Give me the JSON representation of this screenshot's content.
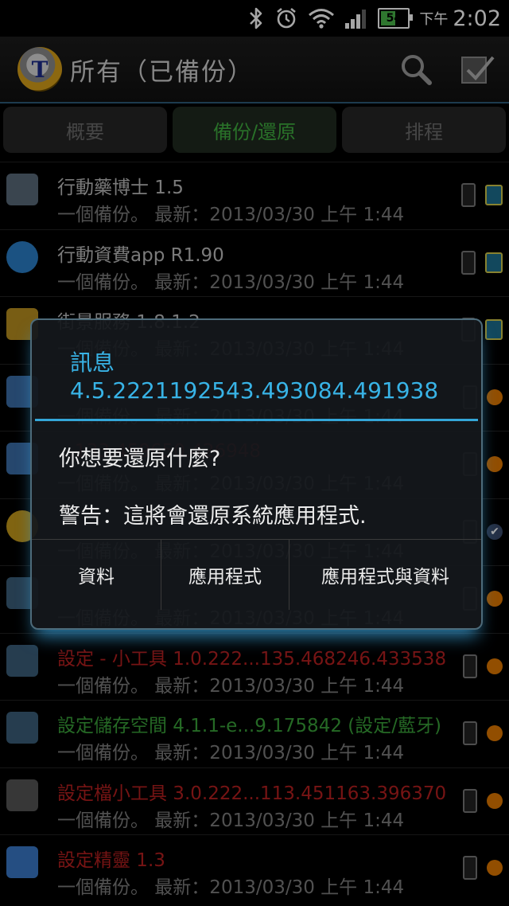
{
  "status_bar": {
    "battery": "54",
    "ampm": "下午",
    "time": "2:02",
    "battery_level": 0.54
  },
  "action_bar": {
    "title": "所有（已備份）",
    "icons": [
      "titanium-logo",
      "search-icon",
      "batch-check-icon"
    ]
  },
  "tabs": [
    "概要",
    "備份/還原",
    "排程"
  ],
  "active_tab": 1,
  "apps": [
    {
      "name": "行動藥博士 1.5",
      "sub": "一個備份。 最新：2013/03/30 上午 1:44",
      "color": "white",
      "right": "sd"
    },
    {
      "name": "行動資費app R1.90",
      "sub": "一個備份。 最新：2013/03/30 上午 1:44",
      "color": "white",
      "right": "sd"
    },
    {
      "name": "街景服務 1.8.1.2",
      "sub": "一個備份。 最新：2013/03/30 上午 1:44",
      "color": "white",
      "right": "sd"
    },
    {
      "name": "",
      "sub": "一個備份。 最新：2013/03/30 上午 1:44",
      "color": "green",
      "right": "face"
    },
    {
      "name": "...133.459650.426948",
      "sub": "一個備份。 最新：2013/03/30 上午 1:44",
      "color": "red",
      "right": "face"
    },
    {
      "name": "",
      "sub": "一個備份。 最新：2013/03/30 上午 1:44",
      "color": "white",
      "right": "check"
    },
    {
      "name": "",
      "sub": "一個備份。 最新：2013/03/30 上午 1:44",
      "color": "green",
      "right": "face"
    },
    {
      "name": "設定 - 小工具 1.0.222...135.468246.433538",
      "sub": "一個備份。 最新：2013/03/30 上午 1:44",
      "color": "red",
      "right": "face"
    },
    {
      "name": "設定儲存空間 4.1.1-e...9.175842 (設定/藍牙)",
      "sub": "一個備份。 最新：2013/03/30 上午 1:44",
      "color": "green",
      "right": "face"
    },
    {
      "name": "設定檔小工具 3.0.222...113.451163.396370",
      "sub": "一個備份。 最新：2013/03/30 上午 1:44",
      "color": "red",
      "right": "face"
    },
    {
      "name": "設定精靈 1.3",
      "sub": "一個備份。 最新：2013/03/30 上午 1:44",
      "color": "red",
      "right": "face"
    }
  ],
  "dialog": {
    "title": "訊息",
    "subtitle": "4.5.2221192543.493084.491938",
    "message": "你想要還原什麼?",
    "warning": "警告：這將會還原系統應用程式.",
    "buttons": [
      "資料",
      "應用程式",
      "應用程式與資料"
    ]
  }
}
